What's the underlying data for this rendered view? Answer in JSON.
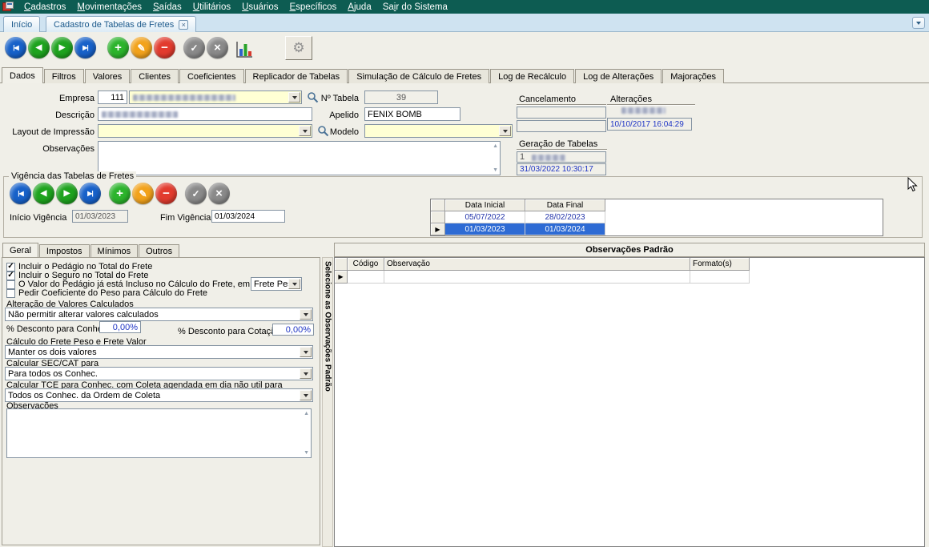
{
  "menubar": {
    "items": [
      {
        "pre": "",
        "u": "C",
        "rest": "adastros"
      },
      {
        "pre": "",
        "u": "M",
        "rest": "ovimentações"
      },
      {
        "pre": "",
        "u": "S",
        "rest": "aídas"
      },
      {
        "pre": "",
        "u": "U",
        "rest": "tilitários"
      },
      {
        "pre": "",
        "u": "U",
        "rest": "suários"
      },
      {
        "pre": "",
        "u": "E",
        "rest": "specíficos"
      },
      {
        "pre": "",
        "u": "A",
        "rest": "juda"
      },
      {
        "pre": "Sa",
        "u": "i",
        "rest": "r do Sistema"
      }
    ]
  },
  "window_tabs": {
    "home": "Início",
    "active": "Cadastro de Tabelas de Fretes"
  },
  "main_tabs": [
    "Dados",
    "Filtros",
    "Valores",
    "Clientes",
    "Coeficientes",
    "Replicador de Tabelas",
    "Simulação de Cálculo de Fretes",
    "Log de Recálculo",
    "Log de Alterações",
    "Majorações"
  ],
  "icons": {
    "first": "|◀",
    "prior": "◀",
    "next": "▶",
    "last": "▶|",
    "insert": "+",
    "edit": "✎",
    "delete": "−",
    "confirm": "✓",
    "cancel": "×",
    "settings": "⚙",
    "close": "×",
    "up": "▲",
    "down": "▼",
    "marker": "▶"
  },
  "form": {
    "empresa_label": "Empresa",
    "empresa_code": "111",
    "n_tabela_label": "Nº Tabela",
    "n_tabela_value": "39",
    "descricao_label": "Descrição",
    "apelido_label": "Apelido",
    "apelido_value": "FENIX BOMB",
    "layout_label": "Layout de Impressão",
    "modelo_label": "Modelo",
    "observacoes_label": "Observações",
    "cancelamento_label": "Cancelamento",
    "alteracoes_label": "Alterações",
    "alteracoes_datetime": "10/10/2017 16:04:29",
    "geracao_label": "Geração de Tabelas",
    "geracao_numero": "1",
    "geracao_datetime": "31/03/2022 10:30:17"
  },
  "vigencia": {
    "legend": "Vigência das Tabelas de Fretes",
    "inicio_label": "Início Vigência",
    "inicio_value": "01/03/2023",
    "fim_label": "Fim Vigência",
    "fim_value": "01/03/2024",
    "grid": {
      "col_inicial": "Data Inicial",
      "col_final": "Data Final",
      "selected_row_index": 1,
      "rows": [
        {
          "inicial": "05/07/2022",
          "final": "28/02/2023"
        },
        {
          "inicial": "01/03/2023",
          "final": "01/03/2024"
        }
      ]
    }
  },
  "sub_tabs": [
    "Geral",
    "Impostos",
    "Mínimos",
    "Outros"
  ],
  "geral": {
    "checks": {
      "pedagio": "✓",
      "seguro": "✓",
      "valor_pedagio": "",
      "coeficiente": ""
    },
    "cb_pedagio": "Incluir o Pedágio no Total do Frete",
    "cb_seguro": "Incluir o Seguro no Total do Frete",
    "cb_valor_pedagio": "O Valor do Pedágio já está Incluso no Cálculo do Frete, em",
    "cb_valor_pedagio_combo": "Frete Peso",
    "cb_coeficiente": "Pedir Coeficiente do Peso para Cálculo do Frete",
    "alteracao_label": "Alteração de Valores Calculados",
    "alteracao_value": "Não permitir alterar valores calculados",
    "desconto_conhec_label": "% Desconto para Conhec.",
    "desconto_conhec_value": "0,00%",
    "desconto_cotacao_label": "% Desconto para Cotação",
    "desconto_cotacao_value": "0,00%",
    "calculo_label": "Cálculo do Frete Peso e Frete Valor",
    "calculo_value": "Manter os dois valores",
    "seccat_label": "Calcular SEC/CAT para",
    "seccat_value": "Para todos os Conhec.",
    "tce_label": "Calcular TCE para Conhec. com  Coleta agendada em dia não util para",
    "tce_value": "Todos os Conhec. da Ordem de Coleta",
    "observacoes_label": "Observações"
  },
  "obs_padrao": {
    "splitter_label": "Selecione as Observações Padrão",
    "header": "Observações Padrão",
    "col_codigo": "Código",
    "col_observacao": "Observação",
    "col_formato": "Formato(s)"
  }
}
